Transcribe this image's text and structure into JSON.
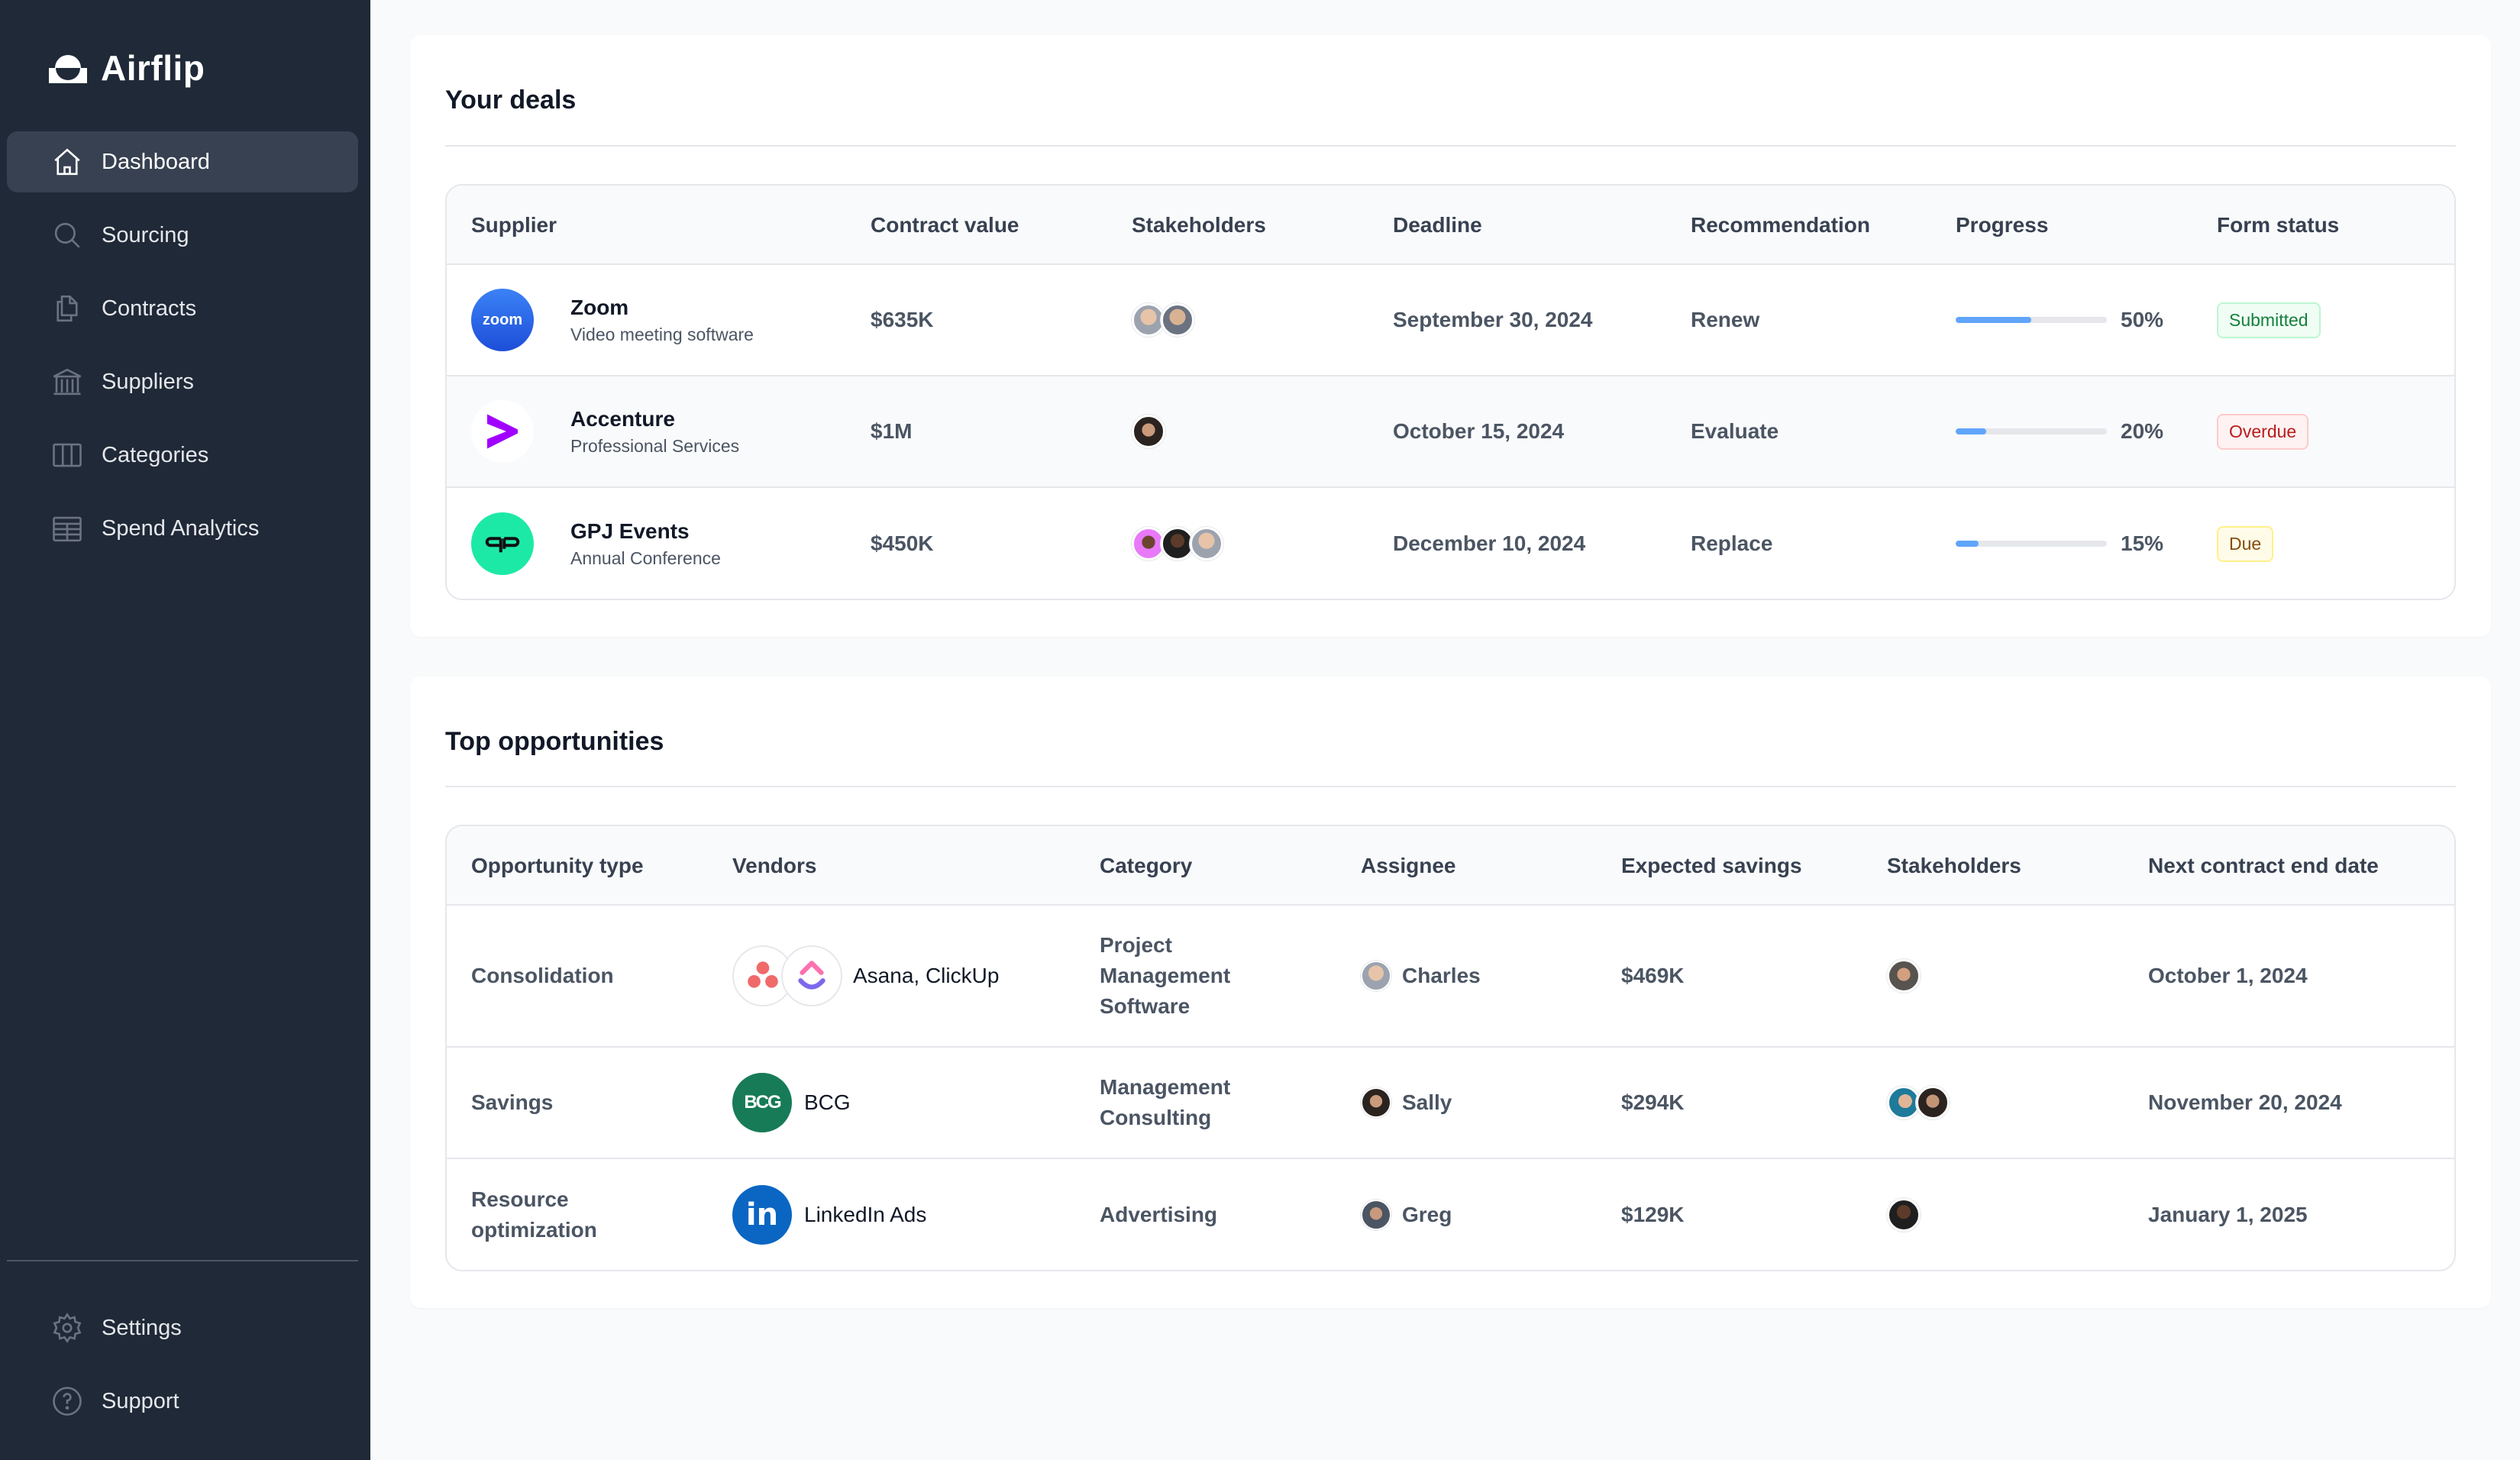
{
  "app": {
    "name": "Airflip"
  },
  "sidebar": {
    "items": [
      {
        "label": "Dashboard",
        "icon": "home-icon",
        "active": true
      },
      {
        "label": "Sourcing",
        "icon": "search-icon"
      },
      {
        "label": "Contracts",
        "icon": "documents-icon"
      },
      {
        "label": "Suppliers",
        "icon": "building-icon"
      },
      {
        "label": "Categories",
        "icon": "columns-icon"
      },
      {
        "label": "Spend Analytics",
        "icon": "table-icon"
      }
    ],
    "footer_items": [
      {
        "label": "Settings",
        "icon": "gear-icon"
      },
      {
        "label": "Support",
        "icon": "question-circle-icon"
      }
    ]
  },
  "deals": {
    "title": "Your deals",
    "columns": [
      "Supplier",
      "Contract value",
      "Stakeholders",
      "Deadline",
      "Recommendation",
      "Progress",
      "Form status"
    ],
    "rows": [
      {
        "supplier": "Zoom",
        "description": "Video meeting software",
        "logo_text": "zoom",
        "logo_color": "#2563eb",
        "contract_value": "$635K",
        "stakeholders": 2,
        "deadline": "September 30, 2024",
        "recommendation": "Renew",
        "progress": 50,
        "progress_label": "50%",
        "status": "Submitted",
        "status_type": "green"
      },
      {
        "supplier": "Accenture",
        "description": "Professional Services",
        "logo_text": ">",
        "logo_color": "#a100ff",
        "contract_value": "$1M",
        "stakeholders": 1,
        "deadline": "October 15, 2024",
        "recommendation": "Evaluate",
        "progress": 20,
        "progress_label": "20%",
        "status": "Overdue",
        "status_type": "red"
      },
      {
        "supplier": "GPJ Events",
        "description": "Annual Conference",
        "logo_text": "GP",
        "logo_color": "#1de9a6",
        "contract_value": "$450K",
        "stakeholders": 3,
        "deadline": "December 10, 2024",
        "recommendation": "Replace",
        "progress": 15,
        "progress_label": "15%",
        "status": "Due",
        "status_type": "yellow"
      }
    ]
  },
  "opportunities": {
    "title": "Top opportunities",
    "columns": [
      "Opportunity type",
      "Vendors",
      "Category",
      "Assignee",
      "Expected savings",
      "Stakeholders",
      "Next contract end date"
    ],
    "rows": [
      {
        "type": "Consolidation",
        "vendors": "Asana, ClickUp",
        "category": "Project Management Software",
        "assignee": "Charles",
        "savings": "$469K",
        "stakeholders": 1,
        "end_date": "October 1, 2024"
      },
      {
        "type": "Savings",
        "vendors": "BCG",
        "category": "Management Consulting",
        "assignee": "Sally",
        "savings": "$294K",
        "stakeholders": 2,
        "end_date": "November 20, 2024"
      },
      {
        "type": "Resource optimization",
        "vendors": "LinkedIn Ads",
        "category": "Advertising",
        "assignee": "Greg",
        "savings": "$129K",
        "stakeholders": 1,
        "end_date": "January 1, 2025"
      }
    ]
  },
  "colors": {
    "sidebar_bg": "#1f2937",
    "active_bg": "#374151",
    "progress": "#60a5fa"
  }
}
